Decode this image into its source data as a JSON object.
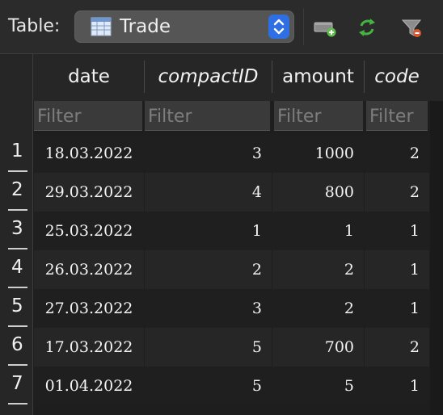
{
  "toolbar": {
    "table_label": "Table:",
    "selected_table": "Trade",
    "icons": [
      "table-icon",
      "new-record-icon",
      "refresh-icon",
      "clear-filters-icon"
    ]
  },
  "columns": [
    {
      "name": "date",
      "italic": false,
      "align": "center"
    },
    {
      "name": "compactID",
      "italic": true,
      "align": "right"
    },
    {
      "name": "amount",
      "italic": false,
      "align": "right"
    },
    {
      "name": "code",
      "italic": true,
      "align": "right"
    }
  ],
  "filter_placeholder": "Filter",
  "rows": [
    {
      "num": "1",
      "cells": [
        "18.03.2022",
        "3",
        "1000",
        "2"
      ]
    },
    {
      "num": "2",
      "cells": [
        "29.03.2022",
        "4",
        "800",
        "2"
      ]
    },
    {
      "num": "3",
      "cells": [
        "25.03.2022",
        "1",
        "1",
        "1"
      ]
    },
    {
      "num": "4",
      "cells": [
        "26.03.2022",
        "2",
        "2",
        "1"
      ]
    },
    {
      "num": "5",
      "cells": [
        "27.03.2022",
        "3",
        "2",
        "1"
      ]
    },
    {
      "num": "6",
      "cells": [
        "17.03.2022",
        "5",
        "700",
        "2"
      ]
    },
    {
      "num": "7",
      "cells": [
        "01.04.2022",
        "5",
        "5",
        "1"
      ]
    }
  ],
  "colors": {
    "accent": "#2f6fe4",
    "new_record_icon": "#5fbf4a",
    "refresh_icon": "#43b540",
    "clear_filter_icon": "#d65a34"
  }
}
